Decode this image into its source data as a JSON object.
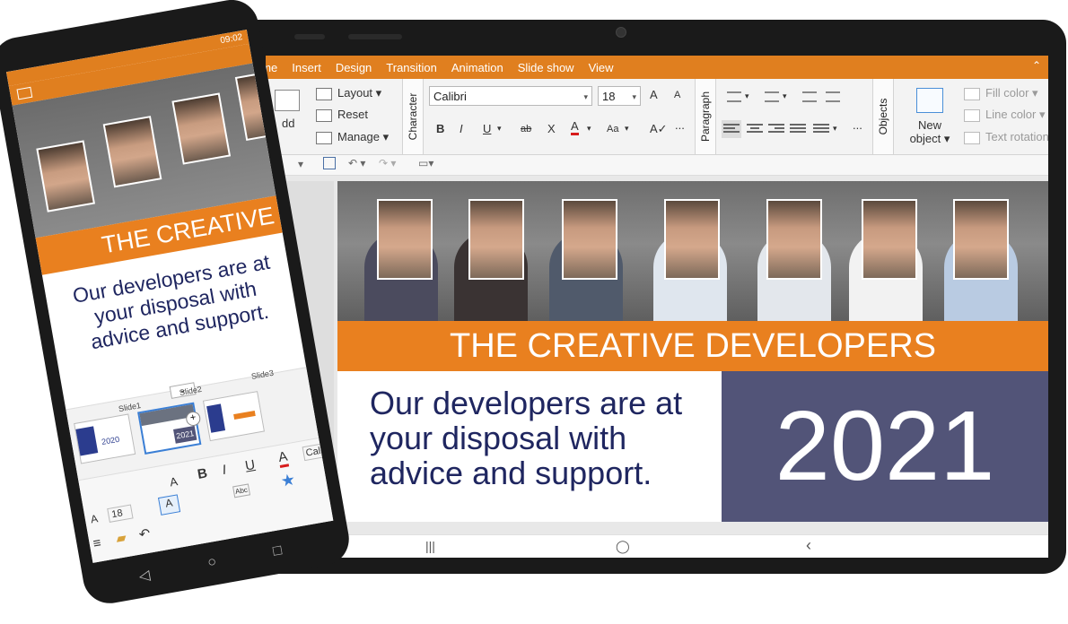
{
  "tablet": {
    "menu_tabs": [
      "ome",
      "Insert",
      "Design",
      "Transition",
      "Animation",
      "Slide show",
      "View"
    ],
    "ribbon": {
      "add_label": "dd",
      "layout_label": "Layout",
      "reset_label": "Reset",
      "manage_label": "Manage",
      "character_group": "Character",
      "font_name": "Calibri",
      "font_size": "18",
      "grow_font": "A",
      "shrink_font": "A",
      "bold": "B",
      "italic": "I",
      "underline": "U",
      "strike": "ab",
      "clear": "X",
      "font_color": "A",
      "case": "Aa",
      "paragraph_group": "Paragraph",
      "objects_group": "Objects",
      "new_object_line1": "New",
      "new_object_line2": "object",
      "fill_color": "Fill color",
      "line_color": "Line color",
      "text_rotation": "Text rotation",
      "overflow": "..."
    },
    "slide": {
      "banner": "THE CREATIVE DEVELOPERS",
      "text": "Our developers are at your disposal with advice and support.",
      "year": "2021"
    },
    "nav": {
      "recent": "|||",
      "home": "◯",
      "back": "‹"
    }
  },
  "phone": {
    "status_time": "09:02",
    "slide": {
      "banner": "THE CREATIVE",
      "text": "Our developers are at your disposal with advice and support."
    },
    "thumbs": [
      {
        "label": "Slide1",
        "subtitle": "2020"
      },
      {
        "label": "Slide2",
        "subtitle": "2021"
      },
      {
        "label": "Slide3",
        "subtitle": ""
      }
    ],
    "toolbar": {
      "font_size": "18",
      "bold": "B",
      "italic": "I",
      "underline": "U",
      "font_color": "A",
      "font_name": "Calib",
      "grow": "A",
      "shrink": "A",
      "text_a": "A",
      "abc": "Abc"
    },
    "nav": {
      "back": "◁",
      "home": "○",
      "recent": "□"
    }
  },
  "colors": {
    "accent": "#e07f1f",
    "navy": "#1f2660",
    "yearbox": "#525478"
  }
}
